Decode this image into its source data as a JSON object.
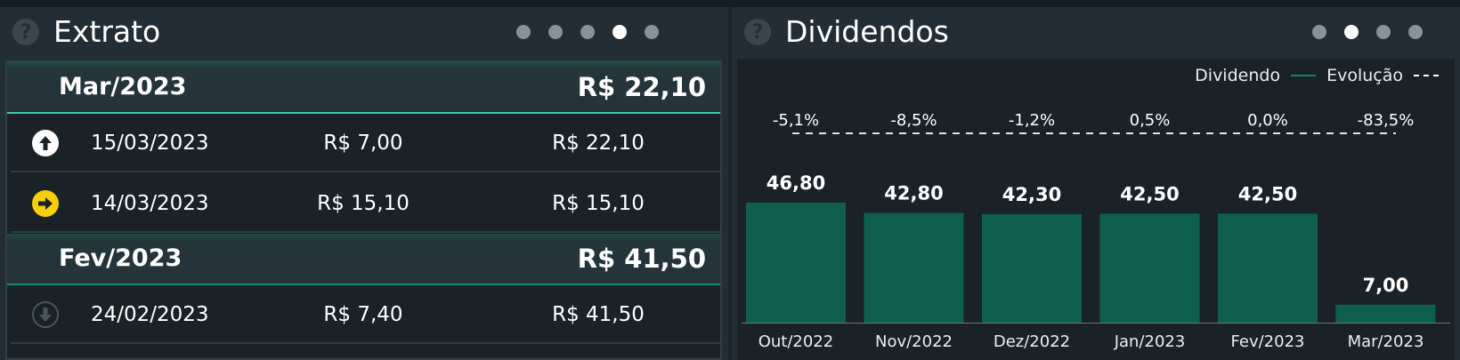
{
  "extrato": {
    "title": "Extrato",
    "help_icon": "?",
    "pager": {
      "count": 5,
      "active": 3
    },
    "groups": [
      {
        "month": "Mar/2023",
        "total": "R$ 22,10",
        "rows": [
          {
            "date": "15/03/2023",
            "value": "R$ 7,00",
            "balance": "R$ 22,10",
            "icon": "arrow-up-icon",
            "color": "#ffffff"
          },
          {
            "date": "14/03/2023",
            "value": "R$ 15,10",
            "balance": "R$ 15,10",
            "icon": "arrow-right-icon",
            "color": "#f6cf0a"
          }
        ]
      },
      {
        "month": "Fev/2023",
        "total": "R$ 41,50",
        "rows": [
          {
            "date": "24/02/2023",
            "value": "R$ 7,40",
            "balance": "R$ 41,50",
            "icon": "arrow-down-icon",
            "color": "#4b555c"
          }
        ]
      }
    ]
  },
  "dividendos": {
    "title": "Dividendos",
    "help_icon": "?",
    "pager": {
      "count": 4,
      "active": 1
    },
    "legend": {
      "series1": "Dividendo",
      "series2": "Evolução"
    },
    "colors": {
      "bar": "#0f5f51",
      "line": "#ffffff",
      "accent": "#37cbb1"
    }
  },
  "chart_data": {
    "type": "bar",
    "categories": [
      "Out/2022",
      "Nov/2022",
      "Dez/2022",
      "Jan/2023",
      "Fev/2023",
      "Mar/2023"
    ],
    "series": [
      {
        "name": "Dividendo",
        "values": [
          46.8,
          42.8,
          42.3,
          42.5,
          42.5,
          7.0
        ],
        "labels": [
          "46,80",
          "42,80",
          "42,30",
          "42,50",
          "42,50",
          "7,00"
        ]
      },
      {
        "name": "Evolução",
        "labels": [
          "-5,1%",
          "-8,5%",
          "-1,2%",
          "0,5%",
          "0,0%",
          "-83,5%"
        ]
      }
    ],
    "ylim": [
      0,
      50
    ],
    "grid": false,
    "legend_position": "top-right"
  }
}
